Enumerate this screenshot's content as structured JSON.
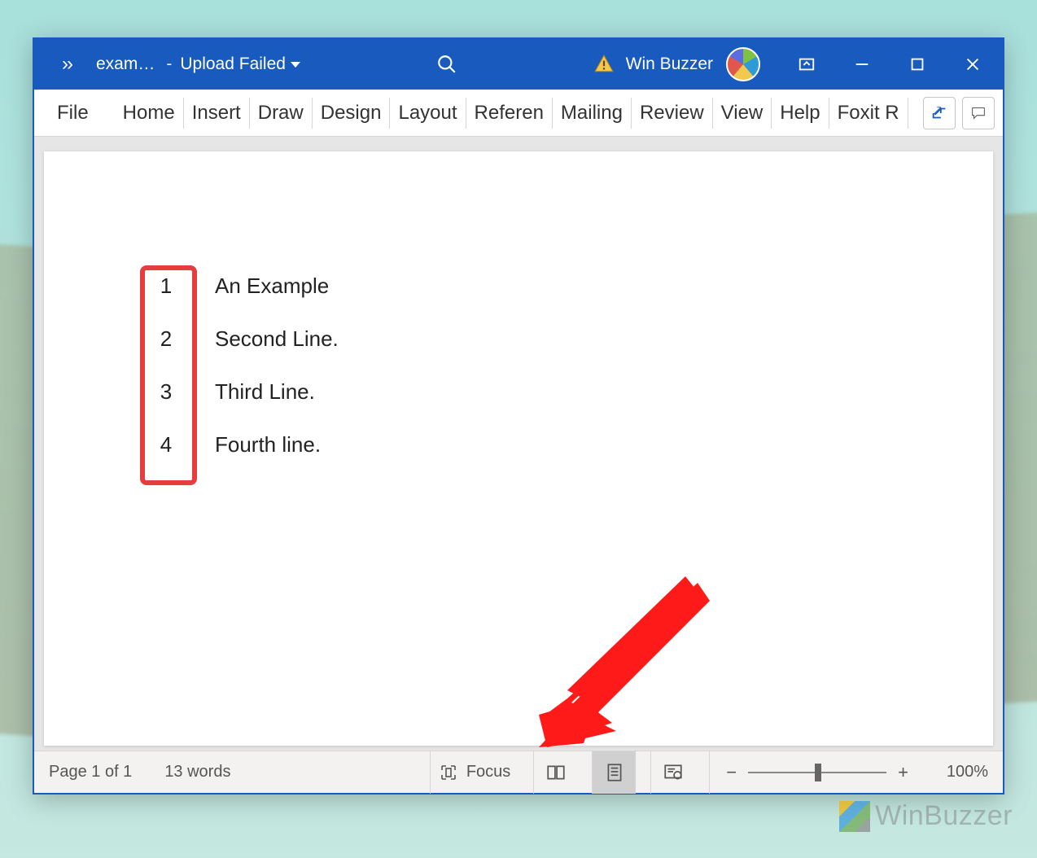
{
  "titlebar": {
    "doc_name": "exam…",
    "status_text": "Upload Failed",
    "username": "Win Buzzer"
  },
  "ribbon": {
    "file": "File",
    "tabs": [
      "Home",
      "Insert",
      "Draw",
      "Design",
      "Layout",
      "Referen",
      "Mailing",
      "Review",
      "View",
      "Help",
      "Foxit R"
    ]
  },
  "document": {
    "lines": [
      {
        "num": "1",
        "text": "An Example"
      },
      {
        "num": "2",
        "text": "Second Line."
      },
      {
        "num": "3",
        "text": "Third Line."
      },
      {
        "num": "4",
        "text": "Fourth line."
      }
    ]
  },
  "statusbar": {
    "page": "Page 1 of 1",
    "words": "13 words",
    "focus": "Focus",
    "zoom": "100%"
  },
  "watermark": "WinBuzzer",
  "annotation": {
    "highlight_box": true,
    "red_arrow_points_to": "print-layout-view-button"
  }
}
